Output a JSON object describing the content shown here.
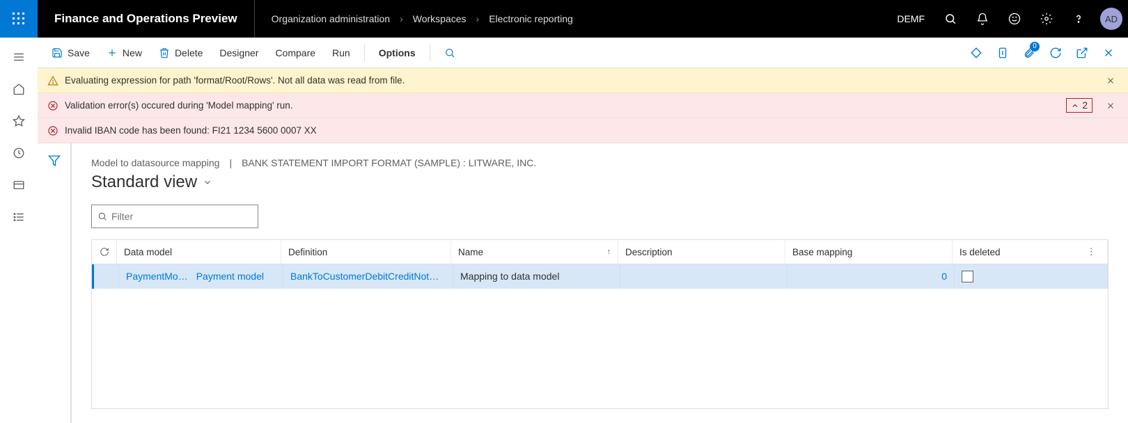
{
  "header": {
    "app_title": "Finance and Operations Preview",
    "breadcrumbs": [
      "Organization administration",
      "Workspaces",
      "Electronic reporting"
    ],
    "company": "DEMF",
    "avatar": "AD"
  },
  "toolbar": {
    "save": "Save",
    "new": "New",
    "delete": "Delete",
    "designer": "Designer",
    "compare": "Compare",
    "run": "Run",
    "options": "Options",
    "badge_count": "0"
  },
  "messages": {
    "warn1": "Evaluating expression for path 'format/Root/Rows'.   Not all data was read from file.",
    "err1": "Validation error(s) occured during 'Model mapping' run.",
    "err1_count": "2",
    "err2": "Invalid IBAN code has been found: FI21 1234 5600 0007 XX"
  },
  "page": {
    "crumb1": "Model to datasource mapping",
    "crumb2": "BANK STATEMENT IMPORT FORMAT (SAMPLE) : LITWARE, INC.",
    "view": "Standard view",
    "filter_placeholder": "Filter"
  },
  "grid": {
    "headers": {
      "data_model": "Data model",
      "definition": "Definition",
      "name": "Name",
      "description": "Description",
      "base_mapping": "Base mapping",
      "is_deleted": "Is deleted"
    },
    "rows": [
      {
        "data_model_short": "PaymentMo…",
        "data_model_full": "Payment model",
        "definition": "BankToCustomerDebitCreditNot…",
        "name": "Mapping to data model",
        "description": "",
        "base_mapping": "0",
        "is_deleted": false
      }
    ]
  }
}
